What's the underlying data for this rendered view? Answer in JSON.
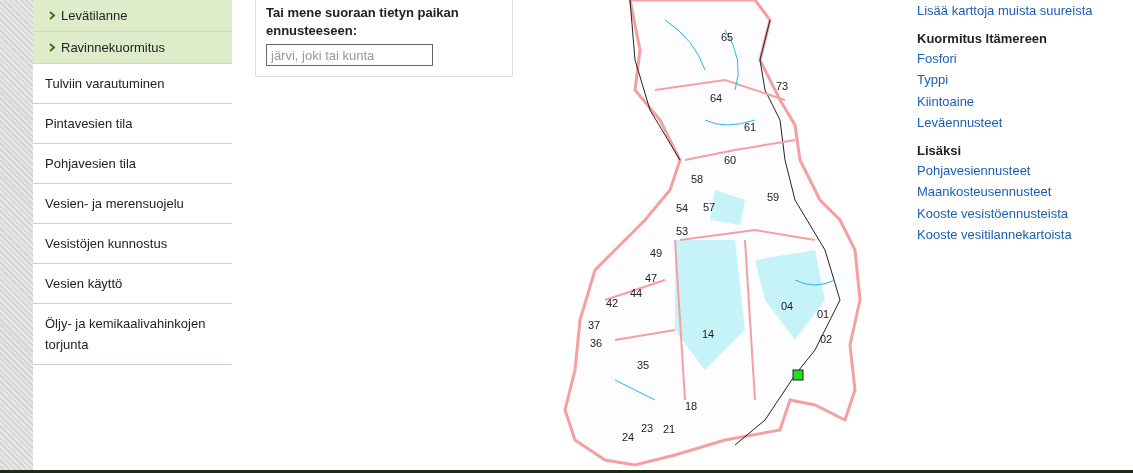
{
  "sidebar": {
    "subitems": [
      {
        "label": "Levätilanne"
      },
      {
        "label": "Ravinnekuormitus"
      }
    ],
    "items": [
      "Tulviin varautuminen",
      "Pintavesien tila",
      "Pohjavesien tila",
      "Vesien- ja merensuojelu",
      "Vesistöjen kunnostus",
      "Vesien käyttö",
      "Öljy- ja kemikaalivahinkojen torjunta"
    ]
  },
  "search": {
    "label": "Tai mene suoraan tietyn paikan ennusteeseen:",
    "placeholder": "järvi, joki tai kunta"
  },
  "map": {
    "labels": [
      "65",
      "73",
      "64",
      "61",
      "60",
      "58",
      "57",
      "59",
      "54",
      "53",
      "49",
      "47",
      "44",
      "42",
      "04",
      "01",
      "02",
      "37",
      "36",
      "14",
      "35",
      "18",
      "23",
      "21",
      "24"
    ]
  },
  "links": {
    "top_link": "Lisää karttoja muista suureista",
    "sections": [
      {
        "heading": "Kuormitus Itämereen",
        "items": [
          "Fosfori",
          "Typpi",
          "Kiintoaine",
          "Leväennusteet"
        ]
      },
      {
        "heading": "Lisäksi",
        "items": [
          "Pohjavesiennusteet",
          "Maankosteusennusteet",
          "Kooste vesistöennusteista",
          "Kooste vesitilannekartoista"
        ]
      }
    ]
  }
}
